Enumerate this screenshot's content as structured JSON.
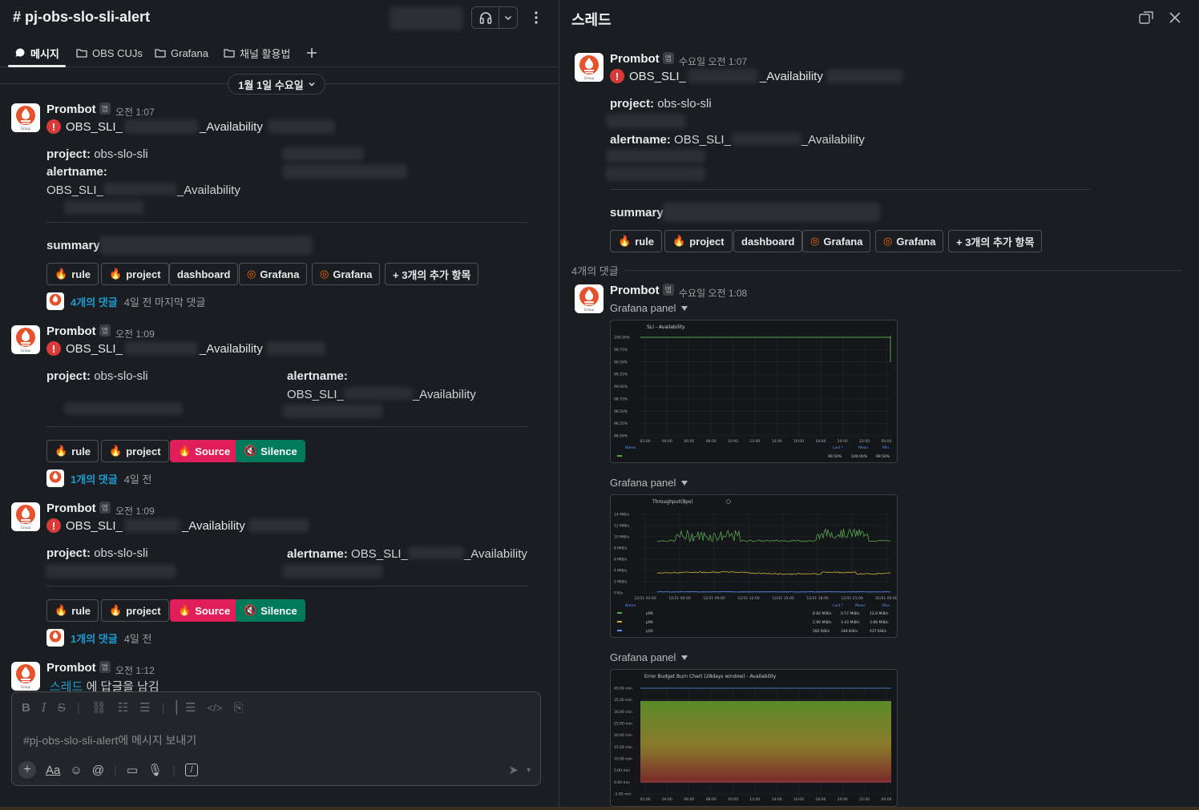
{
  "channel": {
    "title": "# pj-obs-slo-sli-alert",
    "tabs": [
      {
        "label": "메시지",
        "active": true
      },
      {
        "label": "OBS CUJs"
      },
      {
        "label": "Grafana"
      },
      {
        "label": "채널 활용법"
      }
    ],
    "date_divider": "1월 1일 수요일"
  },
  "messages": [
    {
      "sender": "Prombot",
      "badge": "앱",
      "time": "오전 1:07",
      "alert_prefix": "OBS_SLI_",
      "alert_suffix": "_Availability",
      "project_label": "project:",
      "project_value": "obs-slo-sli",
      "alertname_label": "alertname:",
      "alertname_prefix": "OBS_SLI_",
      "alertname_suffix": "_Availability",
      "summary_label": "summary",
      "buttons": [
        "rule",
        "project",
        "dashboard",
        "Grafana",
        "Grafana",
        "+ 3개의 추가 항목"
      ],
      "reply_count": "4개의 댓글",
      "reply_meta": "4일 전 마지막 댓글"
    },
    {
      "sender": "Prombot",
      "badge": "앱",
      "time": "오전 1:09",
      "alert_prefix": "OBS_SLI_",
      "alert_suffix": "_Availability",
      "project_label": "project:",
      "project_value": "obs-slo-sli",
      "alertname_label": "alertname:",
      "alertname_prefix": "OBS_SLI_",
      "alertname_suffix": "_Availability",
      "buttons": [
        "rule",
        "project",
        "Source",
        "Silence"
      ],
      "reply_count": "1개의 댓글",
      "reply_meta": "4일 전"
    },
    {
      "sender": "Prombot",
      "badge": "앱",
      "time": "오전 1:09",
      "alert_prefix": "OBS_SLI_",
      "alert_suffix": "_Availability",
      "project_label": "project:",
      "project_value": "obs-slo-sli",
      "alertname_label": "alertname:",
      "alertname_prefix": "OBS_SLI_",
      "alertname_suffix": "_Availability",
      "buttons": [
        "rule",
        "project",
        "Source",
        "Silence"
      ],
      "reply_count": "1개의 댓글",
      "reply_meta": "4일 전"
    },
    {
      "sender": "Prombot",
      "badge": "앱",
      "time": "오전 1:12",
      "thread_link": "스레드",
      "thread_text": "에 답글을 남김"
    }
  ],
  "composer": {
    "placeholder": "#pj-obs-slo-sli-alert에 메시지 보내기",
    "font_label": "Aa"
  },
  "thread": {
    "title": "스레드",
    "parent": {
      "sender": "Prombot",
      "badge": "앱",
      "time": "수요일 오전 1:07",
      "alert_prefix": "OBS_SLI_",
      "alert_suffix": "_Availability",
      "project_label": "project:",
      "project_value": "obs-slo-sli",
      "alertname_label": "alertname:",
      "alertname_prefix": "OBS_SLI_",
      "alertname_suffix": "_Availability",
      "summary_label": "summary",
      "buttons": [
        "rule",
        "project",
        "dashboard",
        "Grafana",
        "Grafana",
        "+ 3개의 추가 항목"
      ]
    },
    "replies_label": "4개의 댓글",
    "reply": {
      "sender": "Prombot",
      "badge": "앱",
      "time": "수요일 오전 1:08"
    },
    "panels": [
      {
        "label": "Grafana panel",
        "title": "SLI - Availability",
        "y_ticks": [
          "100.00%",
          "99.75%",
          "99.50%",
          "99.25%",
          "99.00%",
          "98.75%",
          "98.50%",
          "98.25%",
          "98.00%"
        ],
        "x_ticks": [
          "02:00",
          "04:00",
          "06:00",
          "08:00",
          "10:00",
          "12:00",
          "14:00",
          "16:00",
          "18:00",
          "20:00",
          "22:00",
          "00:00"
        ],
        "legend_headers": [
          "Name",
          "Last *",
          "Mean",
          "Min"
        ],
        "legend_values": [
          "99.50%",
          "100.00%",
          "99.50%"
        ]
      },
      {
        "label": "Grafana panel",
        "title": "Throughput(Bps)",
        "y_ticks": [
          "14 MiB/s",
          "12 MiB/s",
          "10 MiB/s",
          "8 MiB/s",
          "6 MiB/s",
          "4 MiB/s",
          "2 MiB/s",
          "0 B/s"
        ],
        "x_ticks": [
          "12/31 03:00",
          "12/31 06:00",
          "12/31 09:00",
          "12/31 12:00",
          "12/31 15:00",
          "12/31 18:00",
          "12/31 21:00",
          "01/01 00:00"
        ],
        "legend_headers": [
          "Name",
          "Last *",
          "Mean",
          "Max"
        ],
        "legend_rows": [
          {
            "name": "p99",
            "last": "8.82 MiB/s",
            "mean": "0.57 MiB/s",
            "max": "12.8 MiB/s"
          },
          {
            "name": "p90",
            "last": "2.90 MiB/s",
            "mean": "3.43 MiB/s",
            "max": "3.88 MiB/s"
          },
          {
            "name": "p50",
            "last": "282 KiB/s",
            "mean": "348 KiB/s",
            "max": "437 KiB/s"
          }
        ]
      },
      {
        "label": "Grafana panel",
        "title": "Error Budget Burn Chart (28days window) - Availability",
        "y_ticks": [
          "40.00 min",
          "35.00 min",
          "30.00 min",
          "25.00 min",
          "20.00 min",
          "15.00 min",
          "10.00 min",
          "5.00 min",
          "0.00 min",
          "-5.00 min"
        ],
        "x_ticks": [
          "02:00",
          "04:00",
          "06:00",
          "08:00",
          "10:00",
          "12:00",
          "14:00",
          "16:00",
          "18:00",
          "20:00",
          "22:00",
          "00:00"
        ]
      }
    ]
  },
  "colors": {
    "bg": "#1a1d21",
    "link": "#1d9bd1",
    "source_button": "#e01e5a",
    "silence_button": "#007a5a",
    "alert_red": "#d83a3a"
  }
}
